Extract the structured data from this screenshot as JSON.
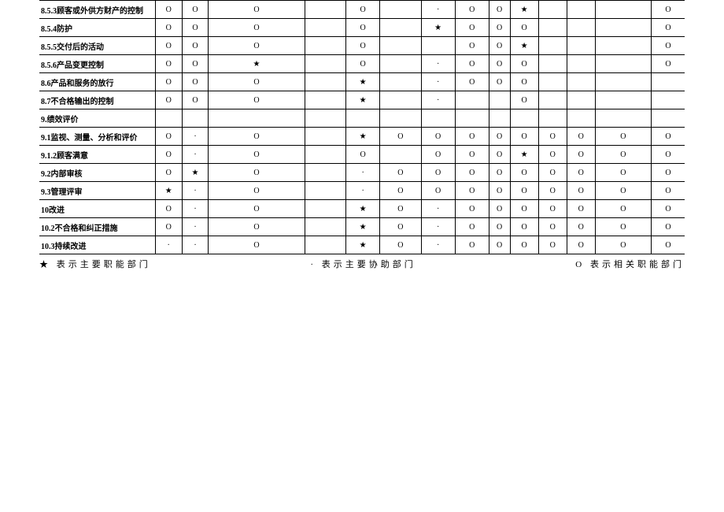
{
  "symbols": {
    "star": "★",
    "circle": "O",
    "dot": "·"
  },
  "legend": {
    "star_text": "★ 表示主要职能部门",
    "dot_text": "· 表示主要协助部门",
    "circle_text": "O 表示相关职能部门"
  },
  "rows": [
    {
      "label": "8.5.3顾客或外供方财产的控制",
      "cells": [
        "O",
        "O",
        "O",
        "",
        "O",
        "",
        "·",
        "O",
        "O",
        "★",
        "",
        "",
        "",
        "O"
      ]
    },
    {
      "label": "8.5.4防护",
      "cells": [
        "O",
        "O",
        "O",
        "",
        "O",
        "",
        "★",
        "O",
        "O",
        "O",
        "",
        "",
        "",
        "O"
      ]
    },
    {
      "label": "8.5.5交付后的活动",
      "cells": [
        "O",
        "O",
        "O",
        "",
        "O",
        "",
        "",
        "O",
        "O",
        "★",
        "",
        "",
        "",
        "O"
      ]
    },
    {
      "label": "8.5.6产品变更控制",
      "cells": [
        "O",
        "O",
        "★",
        "",
        "O",
        "",
        "·",
        "O",
        "O",
        "O",
        "",
        "",
        "",
        "O"
      ]
    },
    {
      "label": "8.6产品和服务的放行",
      "cells": [
        "O",
        "O",
        "O",
        "",
        "★",
        "",
        "·",
        "O",
        "O",
        "O",
        "",
        "",
        "",
        ""
      ]
    },
    {
      "label": "8.7不合格输出的控制",
      "cells": [
        "O",
        "O",
        "O",
        "",
        "★",
        "",
        "·",
        "",
        "",
        "O",
        "",
        "",
        "",
        ""
      ]
    },
    {
      "label": "9.绩效评价",
      "cells": [
        "",
        "",
        "",
        "",
        "",
        "",
        "",
        "",
        "",
        "",
        "",
        "",
        "",
        ""
      ]
    },
    {
      "label": "9.1监视、测量、分析和评价",
      "cells": [
        "O",
        "·",
        "O",
        "",
        "★",
        "O",
        "O",
        "O",
        "O",
        "O",
        "O",
        "O",
        "O",
        "O"
      ]
    },
    {
      "label": "9.1.2顾客满意",
      "cells": [
        "O",
        "·",
        "O",
        "",
        "O",
        "",
        "O",
        "O",
        "O",
        "★",
        "O",
        "O",
        "O",
        "O"
      ]
    },
    {
      "label": "9.2内部审核",
      "cells": [
        "O",
        "★",
        "O",
        "",
        "·",
        "O",
        "O",
        "O",
        "O",
        "O",
        "O",
        "O",
        "O",
        "O"
      ]
    },
    {
      "label": "9.3管理评审",
      "cells": [
        "★",
        "·",
        "O",
        "",
        "·",
        "O",
        "O",
        "O",
        "O",
        "O",
        "O",
        "O",
        "O",
        "O"
      ]
    },
    {
      "label": "10改进",
      "cells": [
        "O",
        "·",
        "O",
        "",
        "★",
        "O",
        "·",
        "O",
        "O",
        "O",
        "O",
        "O",
        "O",
        "O"
      ]
    },
    {
      "label": "10.2不合格和纠正措施",
      "cells": [
        "O",
        "·",
        "O",
        "",
        "★",
        "O",
        "·",
        "O",
        "O",
        "O",
        "O",
        "O",
        "O",
        "O"
      ]
    },
    {
      "label": "10.3持续改进",
      "cells": [
        "·",
        "·",
        "O",
        "",
        "★",
        "O",
        "·",
        "O",
        "O",
        "O",
        "O",
        "O",
        "O",
        "O"
      ]
    }
  ]
}
